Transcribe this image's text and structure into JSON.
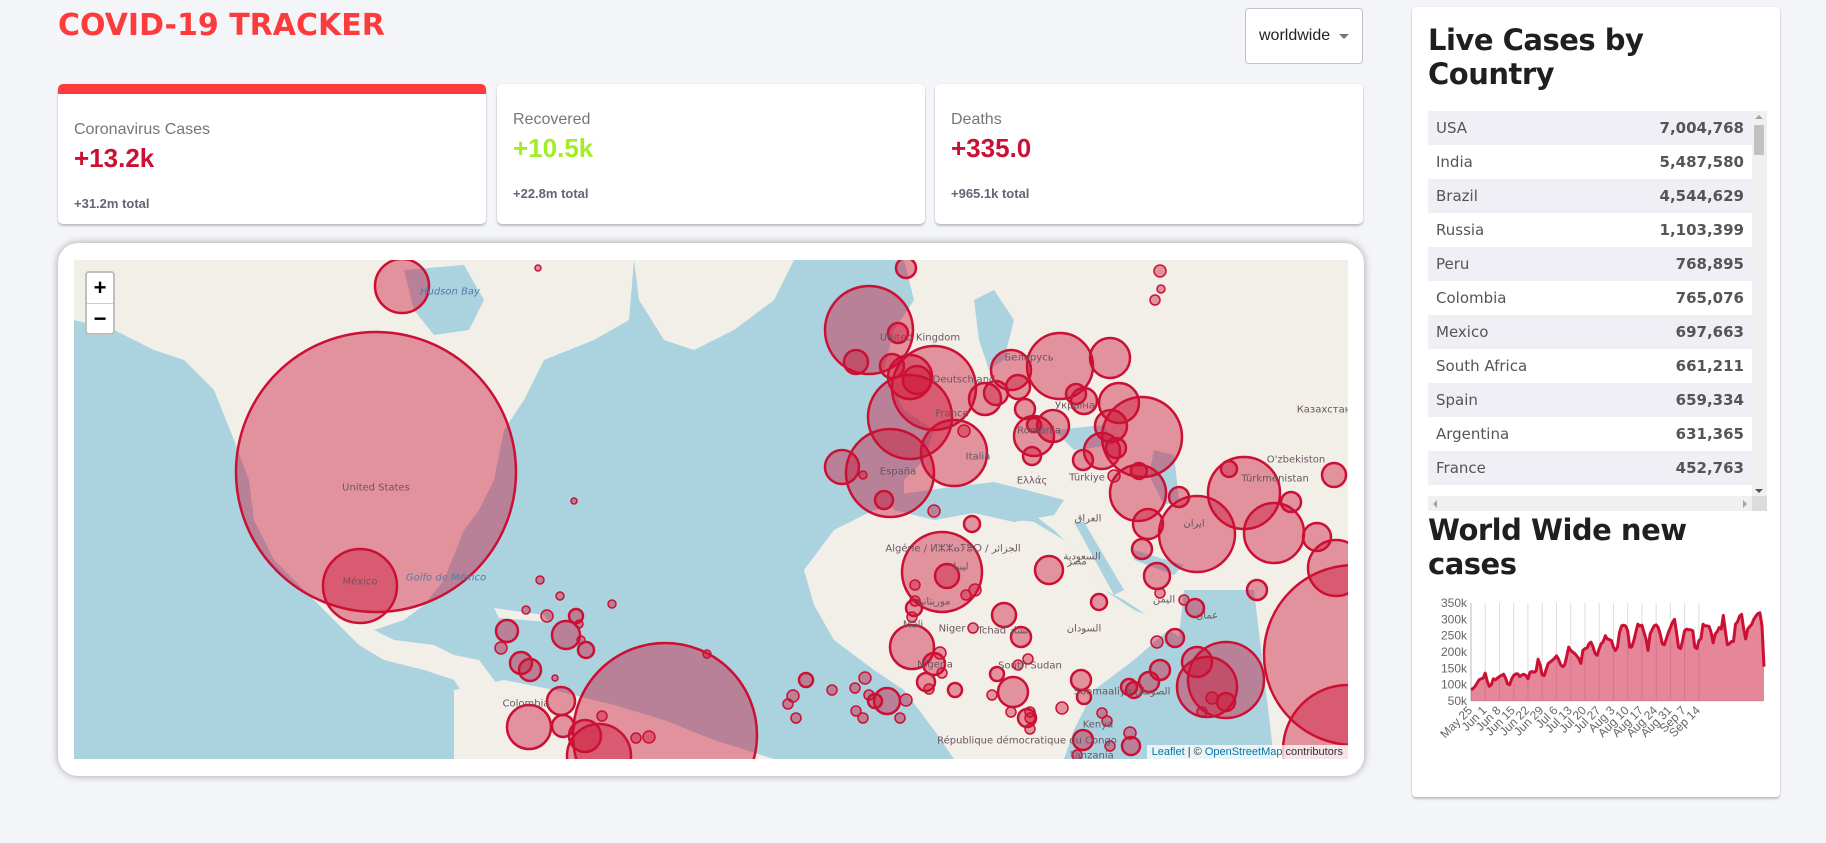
{
  "header": {
    "title": "COVID-19 TRACKER",
    "country_select": {
      "selected": "worldwide"
    }
  },
  "info_cards": [
    {
      "title": "Coronavirus Cases",
      "value": "+13.2k",
      "total": "+31.2m total",
      "color": "#cc1034",
      "selected": true
    },
    {
      "title": "Recovered",
      "value": "+10.5k",
      "total": "+22.8m total",
      "color": "#a3ed26",
      "selected": false
    },
    {
      "title": "Deaths",
      "value": "+335.0",
      "total": "+965.1k total",
      "color": "#cc1034",
      "selected": false
    }
  ],
  "map": {
    "zoom_in": "+",
    "zoom_out": "−",
    "attribution": {
      "leaflet": "Leaflet",
      "sep": " | © ",
      "osm": "OpenStreetMap",
      "rest": " contributors"
    },
    "circle_color": "#cc1034",
    "labels": [
      {
        "text": "Hudson Bay",
        "kind": "water"
      },
      {
        "text": "United States"
      },
      {
        "text": "México"
      },
      {
        "text": "Golfo de México",
        "kind": "water"
      },
      {
        "text": "Colombia"
      },
      {
        "text": "United Kingdom"
      },
      {
        "text": "Deutschland"
      },
      {
        "text": "France"
      },
      {
        "text": "España"
      },
      {
        "text": "Italia"
      },
      {
        "text": "Беларусь"
      },
      {
        "text": "Україна"
      },
      {
        "text": "România"
      },
      {
        "text": "Ελλάς"
      },
      {
        "text": "Türkiye"
      },
      {
        "text": "Казахстан"
      },
      {
        "text": "O'zbekiston"
      },
      {
        "text": "Türkmenistan"
      },
      {
        "text": "العراق"
      },
      {
        "text": "ایران"
      },
      {
        "text": "السعودية"
      },
      {
        "text": "مصر"
      },
      {
        "text": "Algérie / ⵍⵣⵣⴰⵢⴻⵔ / الجزائر"
      },
      {
        "text": "ليبيا"
      },
      {
        "text": "موريتانيا"
      },
      {
        "text": "Mali"
      },
      {
        "text": "Niger"
      },
      {
        "text": "Tchad تشاد"
      },
      {
        "text": "السودان"
      },
      {
        "text": "Nigeria"
      },
      {
        "text": "South Sudan"
      },
      {
        "text": "Soomaaliya الصومال"
      },
      {
        "text": "Kenya"
      },
      {
        "text": "République démocratique du Congo"
      },
      {
        "text": "Tanzania"
      },
      {
        "text": "اليمن"
      },
      {
        "text": "عمان"
      }
    ]
  },
  "sidebar": {
    "table_title": "Live Cases by Country",
    "countries": [
      {
        "country": "USA",
        "cases": "7,004,768"
      },
      {
        "country": "India",
        "cases": "5,487,580"
      },
      {
        "country": "Brazil",
        "cases": "4,544,629"
      },
      {
        "country": "Russia",
        "cases": "1,103,399"
      },
      {
        "country": "Peru",
        "cases": "768,895"
      },
      {
        "country": "Colombia",
        "cases": "765,076"
      },
      {
        "country": "Mexico",
        "cases": "697,663"
      },
      {
        "country": "South Africa",
        "cases": "661,211"
      },
      {
        "country": "Spain",
        "cases": "659,334"
      },
      {
        "country": "Argentina",
        "cases": "631,365"
      },
      {
        "country": "France",
        "cases": "452,763"
      }
    ],
    "chart_title": "World Wide new cases"
  },
  "chart_data": {
    "type": "area",
    "title": "World Wide new cases",
    "xlabel": "",
    "ylabel": "",
    "ylim": [
      50000,
      350000
    ],
    "yticks": [
      "350k",
      "300k",
      "250k",
      "200k",
      "150k",
      "100k",
      "50k"
    ],
    "ytick_values": [
      350000,
      300000,
      250000,
      200000,
      150000,
      100000,
      50000
    ],
    "xticks": [
      "May 25",
      "Jun 1",
      "Jun 8",
      "Jun 15",
      "Jun 22",
      "Jun 29",
      "Jul 6",
      "Jul 13",
      "Jul 20",
      "Jul 27",
      "Aug 3",
      "Aug 10",
      "Aug 17",
      "Aug 24",
      "Aug 31",
      "Sep 7",
      "Sep 14"
    ],
    "grid": "vertical",
    "line_color": "#cc1034",
    "fill_color": "rgba(204,16,52,0.5)",
    "start_date": "May 25",
    "series": [
      {
        "name": "new cases",
        "values": [
          85000,
          88000,
          95000,
          105000,
          115000,
          118000,
          120000,
          135000,
          110000,
          95000,
          100000,
          118000,
          115000,
          120000,
          125000,
          128000,
          132000,
          120000,
          102000,
          100000,
          118000,
          128000,
          133000,
          133000,
          125000,
          130000,
          132000,
          128000,
          118000,
          138000,
          140000,
          138000,
          142000,
          178000,
          160000,
          130000,
          128000,
          148000,
          165000,
          170000,
          175000,
          180000,
          188000,
          178000,
          162000,
          155000,
          160000,
          185000,
          215000,
          205000,
          200000,
          195000,
          188000,
          180000,
          165000,
          205000,
          210000,
          212000,
          225000,
          230000,
          215000,
          195000,
          190000,
          210000,
          225000,
          232000,
          250000,
          240000,
          238000,
          235000,
          215000,
          205000,
          215000,
          260000,
          280000,
          282000,
          280000,
          265000,
          215000,
          215000,
          235000,
          260000,
          285000,
          280000,
          282000,
          260000,
          240000,
          205000,
          255000,
          268000,
          280000,
          283000,
          275000,
          255000,
          225000,
          222000,
          240000,
          260000,
          275000,
          290000,
          300000,
          260000,
          215000,
          210000,
          235000,
          265000,
          270000,
          268000,
          268000,
          265000,
          215000,
          210000,
          235000,
          240000,
          285000,
          280000,
          280000,
          278000,
          260000,
          228000,
          255000,
          262000,
          275000,
          270000,
          312000,
          265000,
          222000,
          225000,
          232000,
          232000,
          285000,
          292000,
          310000,
          315000,
          270000,
          240000,
          270000,
          278000,
          285000,
          300000,
          310000,
          318000,
          320000,
          280000,
          155000
        ]
      }
    ]
  }
}
